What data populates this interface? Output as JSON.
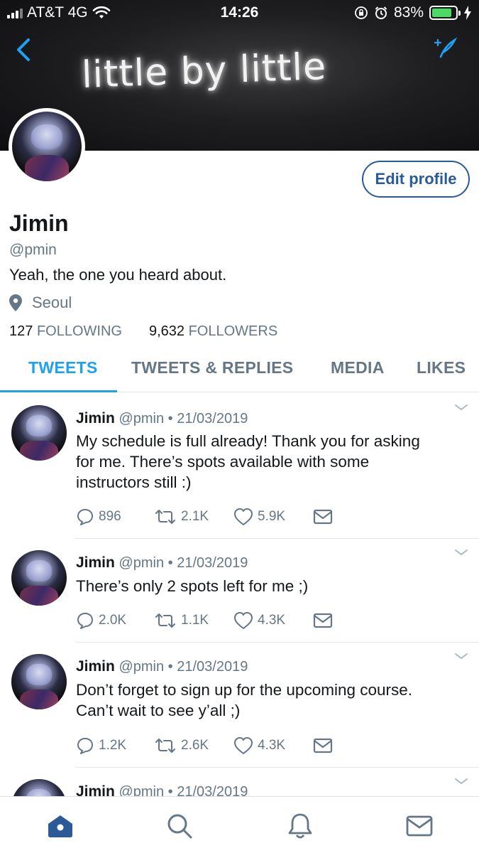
{
  "status_bar": {
    "carrier": "AT&T 4G",
    "time": "14:26",
    "battery": "83%",
    "battery_level": 0.83
  },
  "header": {
    "banner_text": "little by little"
  },
  "profile": {
    "edit_button": "Edit profile",
    "name": "Jimin",
    "handle": "@pmin",
    "bio": "Yeah, the one you heard about.",
    "location": "Seoul",
    "following_count": "127",
    "following_label": "FOLLOWING",
    "followers_count": "9,632",
    "followers_label": "FOLLOWERS"
  },
  "tabs": [
    {
      "label": "TWEETS",
      "active": true
    },
    {
      "label": "TWEETS & REPLIES",
      "active": false
    },
    {
      "label": "MEDIA",
      "active": false
    },
    {
      "label": "LIKES",
      "active": false
    }
  ],
  "tweets": [
    {
      "name": "Jimin",
      "handle": "@pmin",
      "date": "21/03/2019",
      "lines": [
        "My schedule is full already! Thank you for asking",
        "for me. There’s spots available with some",
        "instructors still :)"
      ],
      "replies": "896",
      "retweets": "2.1K",
      "likes": "5.9K"
    },
    {
      "name": "Jimin",
      "handle": "@pmin",
      "date": "21/03/2019",
      "lines": [
        "There’s only 2 spots left for me ;)"
      ],
      "replies": "2.0K",
      "retweets": "1.1K",
      "likes": "4.3K"
    },
    {
      "name": "Jimin",
      "handle": "@pmin",
      "date": "21/03/2019",
      "lines": [
        "Don’t forget to sign up for the upcoming course.",
        "Can’t wait to see y’all ;)"
      ],
      "replies": "1.2K",
      "retweets": "2.6K",
      "likes": "4.3K"
    },
    {
      "name": "Jimin",
      "handle": "@pmin",
      "date": "21/03/2019",
      "lines": []
    }
  ],
  "separator": "•",
  "icons": {
    "back": "chevron-left-icon",
    "compose": "compose-icon",
    "location": "map-pin-icon",
    "reply": "reply-bubble-icon",
    "retweet": "retweet-icon",
    "like": "heart-icon",
    "dm": "envelope-icon",
    "more": "chevron-down-icon",
    "nav_home": "home-icon",
    "nav_search": "search-icon",
    "nav_notifications": "bell-icon",
    "nav_messages": "envelope-icon"
  },
  "colors": {
    "accent": "#1da1f2",
    "edit_button": "#2c5a99",
    "nav_active": "#2c5a99",
    "muted": "#657786"
  }
}
